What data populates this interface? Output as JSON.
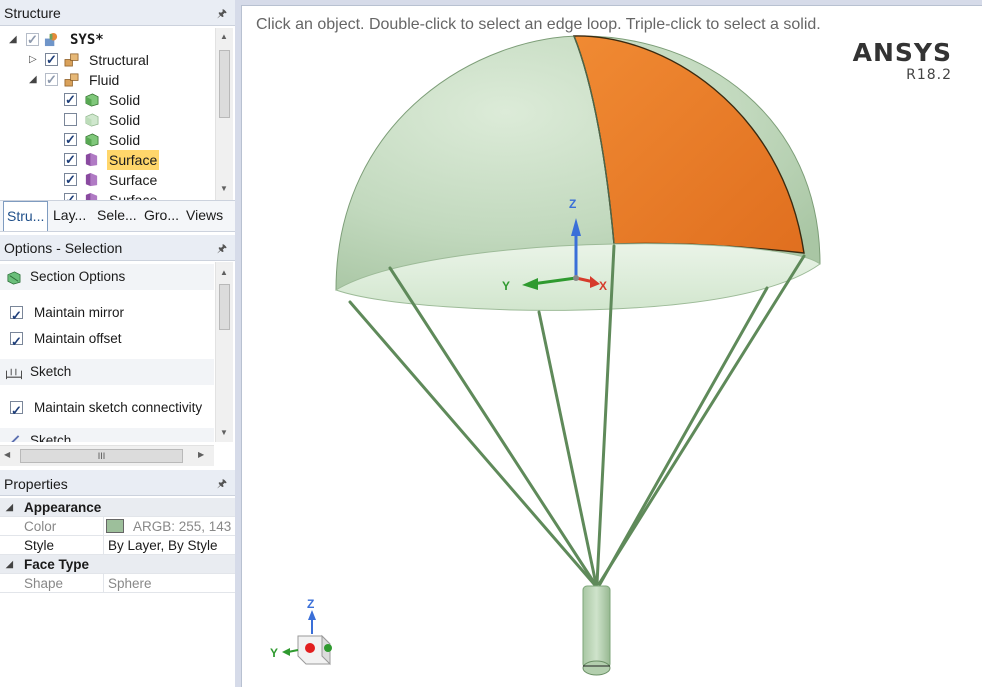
{
  "structure": {
    "title": "Structure",
    "tree": [
      {
        "label": "SYS*",
        "checked": true
      },
      {
        "label": "Structural",
        "checked": true
      },
      {
        "label": "Fluid",
        "checked": true
      },
      {
        "label": "Solid",
        "checked": true
      },
      {
        "label": "Solid",
        "checked": false
      },
      {
        "label": "Solid",
        "checked": true
      },
      {
        "label": "Surface",
        "checked": true,
        "selected": true
      },
      {
        "label": "Surface",
        "checked": true
      },
      {
        "label": "Surface",
        "checked": true
      }
    ],
    "tabs": [
      "Stru...",
      "Lay...",
      "Sele...",
      "Gro...",
      "Views"
    ]
  },
  "options": {
    "title": "Options - Selection",
    "items": [
      {
        "label": "Section Options",
        "type": "section"
      },
      {
        "label": "Maintain mirror",
        "type": "checkbox",
        "checked": true
      },
      {
        "label": "Maintain offset",
        "type": "checkbox",
        "checked": true
      },
      {
        "label": "Sketch",
        "type": "section"
      },
      {
        "label": "Maintain sketch connectivity",
        "type": "checkbox",
        "checked": true
      },
      {
        "label": "Sketch",
        "type": "section"
      }
    ],
    "hscroll_glyph": "III"
  },
  "properties": {
    "title": "Properties",
    "groups": [
      {
        "name": "Appearance",
        "rows": [
          {
            "key": "Color",
            "value": "ARGB: 255, 143",
            "swatch": "#9dbf9b",
            "dim": true
          },
          {
            "key": "Style",
            "value": "By Layer, By Style",
            "dim": false
          }
        ]
      },
      {
        "name": "Face Type",
        "rows": [
          {
            "key": "Shape",
            "value": "Sphere",
            "dim": true
          }
        ]
      }
    ]
  },
  "viewport": {
    "hint": "Click an object. Double-click to select an edge loop. Triple-click to select a solid.",
    "brand": "ANSYS",
    "version": "R18.2",
    "triad": {
      "z": "Z",
      "y": "Y",
      "x": "X"
    },
    "mini_triad": {
      "z": "Z",
      "y": "Y"
    },
    "colors": {
      "canopy": "#c5dbc1",
      "selected_face": "#ec7e2a",
      "lines": "#5f8a5a",
      "payload": "#b3cfae",
      "axis_z": "#3a6fd8",
      "axis_y": "#2f9a2f",
      "axis_x": "#d63b2b"
    }
  }
}
